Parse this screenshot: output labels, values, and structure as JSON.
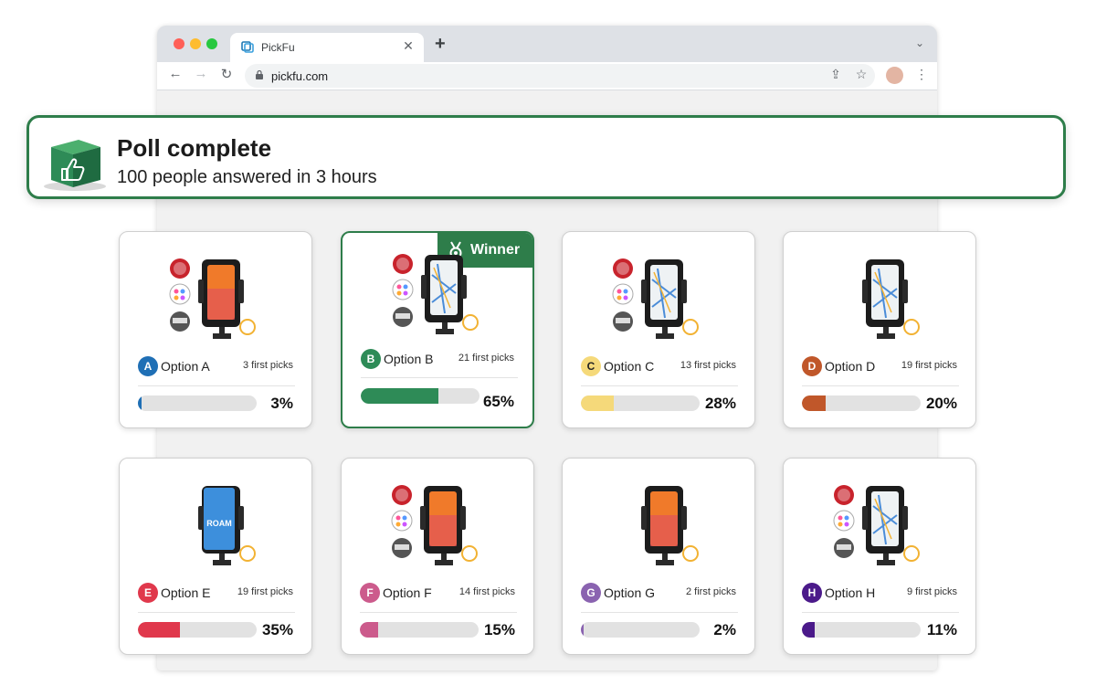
{
  "browser": {
    "tab_title": "PickFu",
    "url": "pickfu.com",
    "close_glyph": "✕",
    "new_tab_glyph": "+",
    "menu_glyph": "⌄",
    "back_glyph": "←",
    "forward_glyph": "→",
    "reload_glyph": "↻",
    "share_glyph": "⇪",
    "star_glyph": "☆",
    "kebab_glyph": "⋮"
  },
  "banner": {
    "title": "Poll complete",
    "subtitle": "100 people answered in 3 hours",
    "icon": "thumbs-up-cube-icon"
  },
  "winner_label": "Winner",
  "options": [
    {
      "letter": "A",
      "label": "Option A",
      "picks": "3 first picks",
      "percent_text": "3%",
      "percent": 3,
      "color": "#1f6fb5",
      "winner": false,
      "phone": "orange"
    },
    {
      "letter": "B",
      "label": "Option B",
      "picks": "21 first picks",
      "percent_text": "65%",
      "percent": 65,
      "color": "#2e8b57",
      "winner": true,
      "phone": "map"
    },
    {
      "letter": "C",
      "label": "Option C",
      "picks": "13 first picks",
      "percent_text": "28%",
      "percent": 28,
      "color": "#f5d97a",
      "letter_color": "#222",
      "winner": false,
      "phone": "map"
    },
    {
      "letter": "D",
      "label": "Option D",
      "picks": "19 first picks",
      "percent_text": "20%",
      "percent": 20,
      "color": "#c0572a",
      "winner": false,
      "phone": "map"
    },
    {
      "letter": "E",
      "label": "Option E",
      "picks": "19 first picks",
      "percent_text": "35%",
      "percent": 35,
      "color": "#e0384c",
      "winner": false,
      "phone": "blue"
    },
    {
      "letter": "F",
      "label": "Option F",
      "picks": "14 first picks",
      "percent_text": "15%",
      "percent": 15,
      "color": "#cc5b8c",
      "winner": false,
      "phone": "orange"
    },
    {
      "letter": "G",
      "label": "Option G",
      "picks": "2 first picks",
      "percent_text": "2%",
      "percent": 2,
      "color": "#8a63b0",
      "winner": false,
      "phone": "orange"
    },
    {
      "letter": "H",
      "label": "Option H",
      "picks": "9 first picks",
      "percent_text": "11%",
      "percent": 11,
      "color": "#4b1a8a",
      "winner": false,
      "phone": "map"
    }
  ]
}
